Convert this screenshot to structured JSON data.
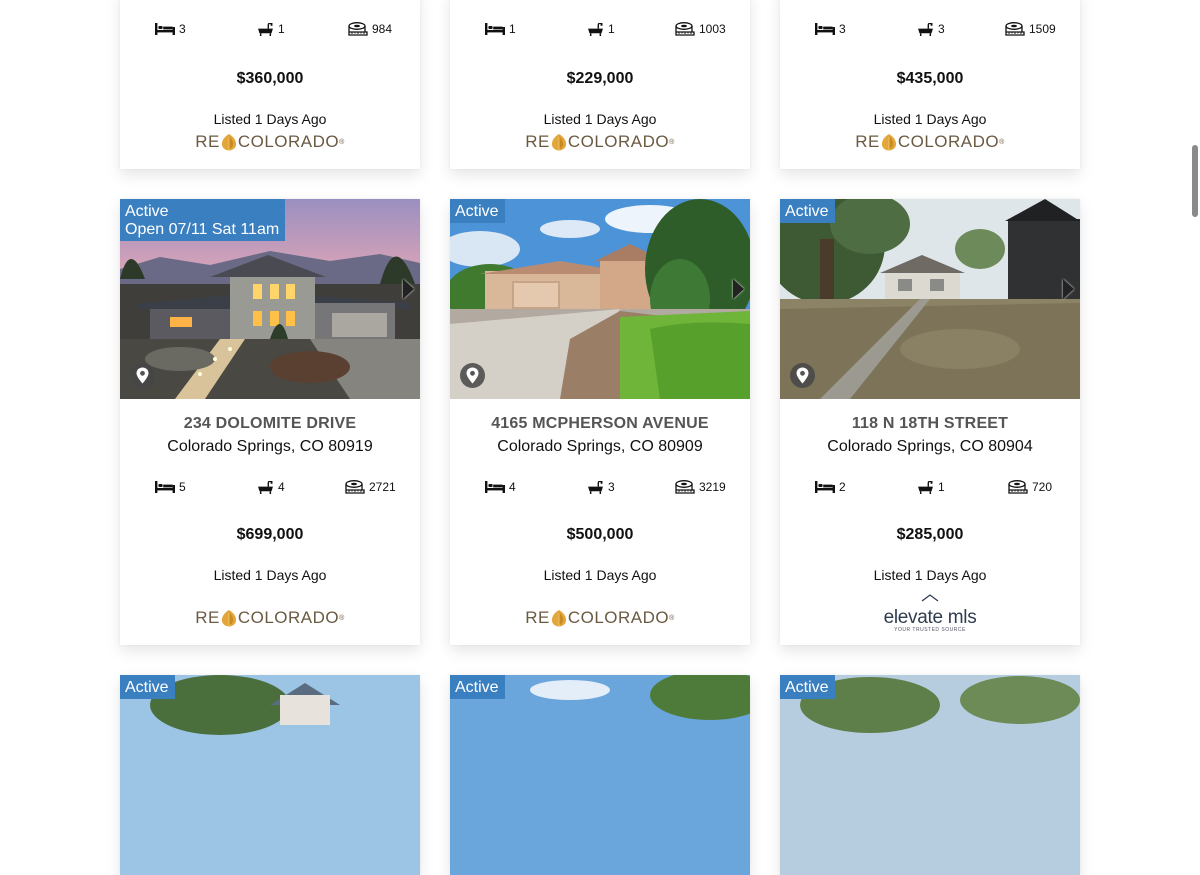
{
  "top_row": [
    {
      "beds": "3",
      "baths": "1",
      "sqft": "984",
      "price": "$360,000",
      "listed": "Listed 1 Days Ago",
      "logo": "recolorado"
    },
    {
      "beds": "1",
      "baths": "1",
      "sqft": "1003",
      "price": "$229,000",
      "listed": "Listed 1 Days Ago",
      "logo": "recolorado"
    },
    {
      "beds": "3",
      "baths": "3",
      "sqft": "1509",
      "price": "$435,000",
      "listed": "Listed 1 Days Ago",
      "logo": "recolorado"
    }
  ],
  "middle_row": [
    {
      "status": "Active",
      "open_house": "Open 07/11 Sat 11am",
      "street": "234 DOLOMITE DRIVE",
      "city": "Colorado Springs, CO 80919",
      "beds": "5",
      "baths": "4",
      "sqft": "2721",
      "price": "$699,000",
      "listed": "Listed 1 Days Ago",
      "logo": "recolorado"
    },
    {
      "status": "Active",
      "street": "4165 MCPHERSON AVENUE",
      "city": "Colorado Springs, CO 80909",
      "beds": "4",
      "baths": "3",
      "sqft": "3219",
      "price": "$500,000",
      "listed": "Listed 1 Days Ago",
      "logo": "recolorado"
    },
    {
      "status": "Active",
      "street": "118 N 18TH STREET",
      "city": "Colorado Springs, CO 80904",
      "beds": "2",
      "baths": "1",
      "sqft": "720",
      "price": "$285,000",
      "listed": "Listed 1 Days Ago",
      "logo": "elevatemls"
    }
  ],
  "bottom_row": [
    {
      "status": "Active"
    },
    {
      "status": "Active"
    },
    {
      "status": "Active"
    }
  ],
  "logos": {
    "recolorado_left": "RE",
    "recolorado_right": "COLORADO",
    "recolorado_mark": "®",
    "elevate_name": "elevate mls",
    "elevate_tagline": "YOUR TRUSTED SOURCE"
  },
  "icons": {
    "beds": "bed-icon",
    "baths": "bathtub-icon",
    "sqft": "tape-measure-icon",
    "location": "map-pin-icon",
    "next": "chevron-right-icon"
  },
  "colors": {
    "badge": "#3a7fc0",
    "price": "#111111",
    "street": "#555555",
    "logo_brown": "#6b5a42",
    "logo_gold": "#e2a63a"
  }
}
